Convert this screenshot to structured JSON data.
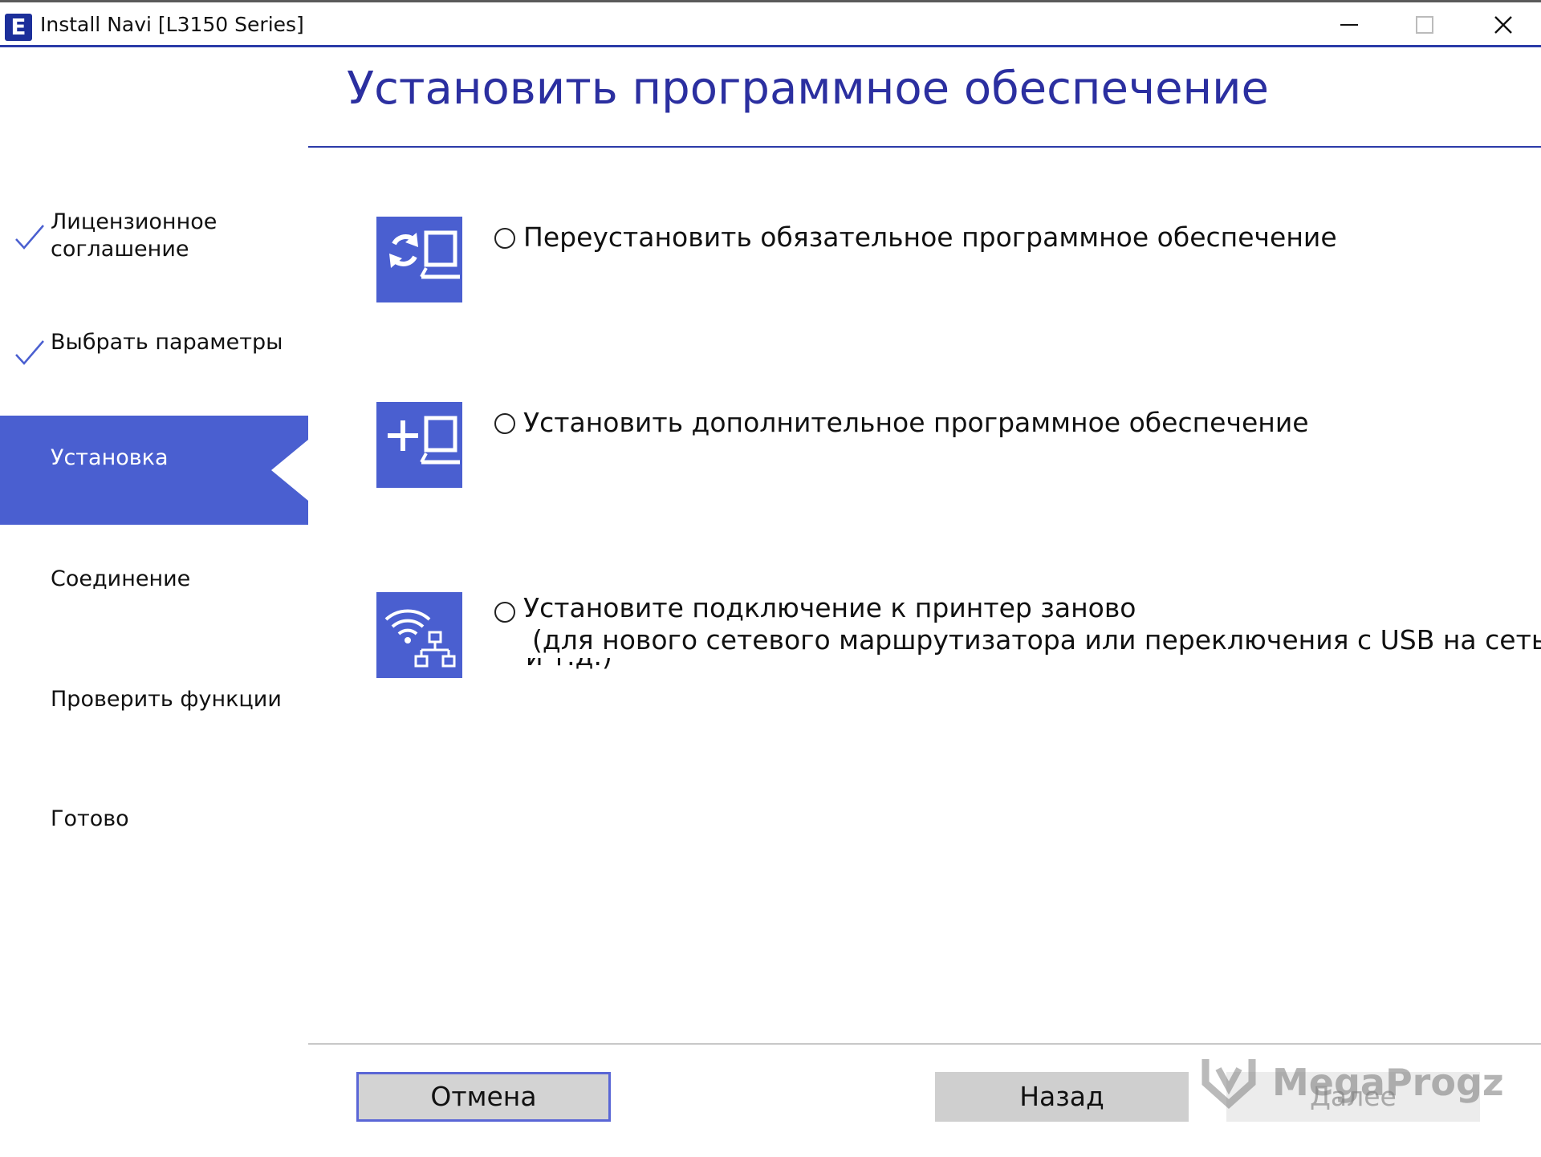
{
  "window": {
    "app_icon_letter": "E",
    "title": "Install Navi [L3150 Series]",
    "controls": [
      "minimize-icon",
      "maximize-icon",
      "close-icon"
    ]
  },
  "header": {
    "title": "Установить программное обеспечение"
  },
  "sidebar": {
    "steps": [
      {
        "label_line1": "Лицензионное",
        "label_line2": "соглашение",
        "state": "done"
      },
      {
        "label": "Выбрать параметры",
        "state": "done"
      },
      {
        "label": "Установка",
        "state": "active"
      },
      {
        "label": "Соединение",
        "state": "pending"
      },
      {
        "label": "Проверить функции",
        "state": "pending"
      },
      {
        "label": "Готово",
        "state": "pending"
      }
    ]
  },
  "options": [
    {
      "label": "Переустановить обязательное программное обеспечение",
      "icon": "reinstall-computer-icon",
      "selected": false
    },
    {
      "label": "Установить дополнительное программное обеспечение",
      "icon": "add-software-computer-icon",
      "selected": false
    },
    {
      "label": "Установите подключение к принтер заново",
      "sub": "(для нового сетевого маршрутизатора или переключения с USB на сеть",
      "sub_cut": "и т.д.)",
      "icon": "wifi-network-icon",
      "selected": false
    }
  ],
  "footer": {
    "cancel_label": "Отмена",
    "back_label": "Назад",
    "next_label": "Далее"
  },
  "watermark": {
    "text": "MegaProgz"
  },
  "colors": {
    "accent": "#4a5fd0",
    "title": "#2b2fa0",
    "rule": "#2b3ba8"
  }
}
